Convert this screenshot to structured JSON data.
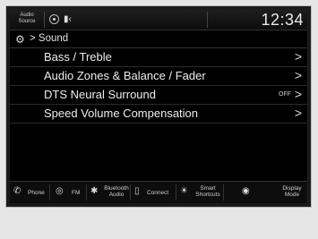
{
  "status_bar": {
    "audio_source_line1": "Audio",
    "audio_source_line2": "Source",
    "clock": "12:34"
  },
  "header": {
    "breadcrumb_separator": ">",
    "title": "Sound"
  },
  "menu": {
    "items": [
      {
        "label": "Bass / Treble",
        "value": ""
      },
      {
        "label": "Audio Zones & Balance / Fader",
        "value": ""
      },
      {
        "label": "DTS Neural Surround",
        "value": "OFF"
      },
      {
        "label": "Speed Volume Compensation",
        "value": ""
      }
    ]
  },
  "bottom_bar": {
    "phone": "Phone",
    "fm": "FM",
    "bluetooth_line1": "Bluetooth",
    "bluetooth_line2": "Audio",
    "connect": "Connect",
    "smart_line1": "Smart",
    "smart_line2": "Shortcuts",
    "display_line1": "Display",
    "display_line2": "Mode"
  },
  "icons": {
    "settings": "gear-icon",
    "phone": "phone-icon",
    "fm": "radio-antenna-icon",
    "bluetooth": "bluetooth-icon",
    "connect": "smartphone-icon",
    "smart": "sun-icon",
    "display": "brightness-icon"
  },
  "colors": {
    "screen_bg": "#000000",
    "text": "#ededed",
    "bezel": "#1b1b1b"
  }
}
